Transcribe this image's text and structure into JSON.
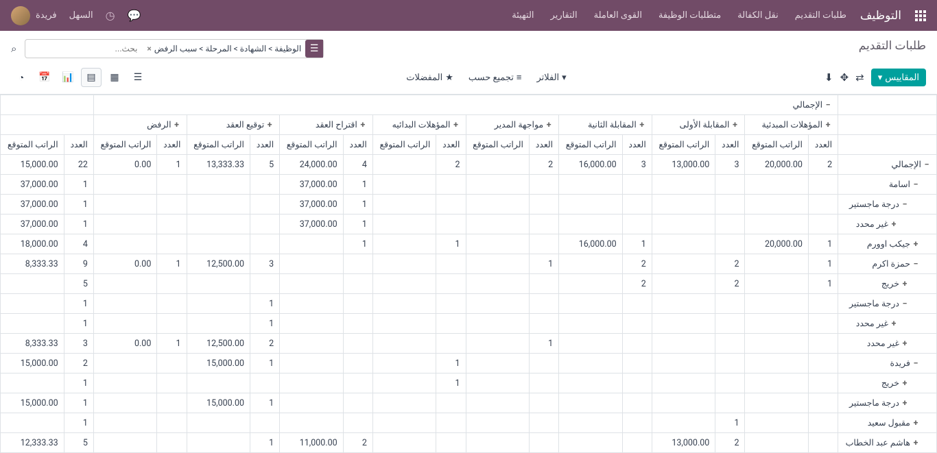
{
  "nav": {
    "brand": "التوظيف",
    "menu": [
      "طلبات التقديم",
      "نقل الكفالة",
      "متطلبات الوظيفة",
      "القوى العاملة",
      "التقارير",
      "التهيئة"
    ],
    "company": "السهل",
    "user": "فريدة"
  },
  "header": {
    "title": "طلبات التقديم",
    "search_chip": "الوظيفة > الشهادة  > المرحلة > سبب الرفض",
    "search_placeholder": "بحث..."
  },
  "toolbar": {
    "measures": "المقاييس",
    "filters": "الفلاتر",
    "groupby": "تجميع حسب",
    "favorites": "المفضلات"
  },
  "pivot": {
    "total_label": "الإجمالي",
    "col_groups": [
      "المؤهلات المبدئية",
      "المقابلة الأولى",
      "المقابلة الثانية",
      "مواجهة المدير",
      "المؤهلات البدائيه",
      "اقتراح العقد",
      "توقيع العقد",
      "الرفض"
    ],
    "sub_cols": [
      "العدد",
      "الراتب المتوقع"
    ],
    "row_total_cols": [
      "العدد",
      "الراتب المتوقع"
    ],
    "rows": [
      {
        "label": "الإجمالي",
        "indent": 0,
        "exp": "−",
        "cells": [
          "2",
          "20,000.00",
          "3",
          "13,000.00",
          "3",
          "16,000.00",
          "2",
          "",
          "2",
          "",
          "4",
          "24,000.00",
          "5",
          "13,333.33",
          "1",
          "0.00"
        ],
        "tot": [
          "22",
          "15,000.00"
        ]
      },
      {
        "label": "اسامة",
        "indent": 1,
        "exp": "−",
        "cells": [
          "",
          "",
          "",
          "",
          "",
          "",
          "",
          "",
          "",
          "",
          "1",
          "37,000.00",
          "",
          "",
          "",
          ""
        ],
        "tot": [
          "1",
          "37,000.00"
        ]
      },
      {
        "label": "درجة ماجستير",
        "indent": 2,
        "exp": "−",
        "cells": [
          "",
          "",
          "",
          "",
          "",
          "",
          "",
          "",
          "",
          "",
          "1",
          "37,000.00",
          "",
          "",
          "",
          ""
        ],
        "tot": [
          "1",
          "37,000.00"
        ]
      },
      {
        "label": "غير محدد",
        "indent": 3,
        "exp": "+",
        "cells": [
          "",
          "",
          "",
          "",
          "",
          "",
          "",
          "",
          "",
          "",
          "1",
          "37,000.00",
          "",
          "",
          "",
          ""
        ],
        "tot": [
          "1",
          "37,000.00"
        ]
      },
      {
        "label": "جيكب اوورم",
        "indent": 1,
        "exp": "+",
        "cells": [
          "1",
          "20,000.00",
          "",
          "",
          "1",
          "16,000.00",
          "",
          "",
          "1",
          "",
          "1",
          "",
          "",
          "",
          "",
          ""
        ],
        "tot": [
          "4",
          "18,000.00"
        ]
      },
      {
        "label": "حمزة اكرم",
        "indent": 1,
        "exp": "−",
        "cells": [
          "1",
          "",
          "2",
          "",
          "2",
          "",
          "1",
          "",
          "",
          "",
          "",
          "",
          "3",
          "12,500.00",
          "1",
          "0.00"
        ],
        "tot": [
          "9",
          "8,333.33"
        ]
      },
      {
        "label": "خريج",
        "indent": 2,
        "exp": "+",
        "cells": [
          "1",
          "",
          "2",
          "",
          "2",
          "",
          "",
          "",
          "",
          "",
          "",
          "",
          "",
          "",
          "",
          ""
        ],
        "tot": [
          "5",
          ""
        ]
      },
      {
        "label": "درجة ماجستير",
        "indent": 2,
        "exp": "−",
        "cells": [
          "",
          "",
          "",
          "",
          "",
          "",
          "",
          "",
          "",
          "",
          "",
          "",
          "1",
          "",
          "",
          ""
        ],
        "tot": [
          "1",
          ""
        ]
      },
      {
        "label": "غير محدد",
        "indent": 3,
        "exp": "+",
        "cells": [
          "",
          "",
          "",
          "",
          "",
          "",
          "",
          "",
          "",
          "",
          "",
          "",
          "1",
          "",
          "",
          ""
        ],
        "tot": [
          "1",
          ""
        ]
      },
      {
        "label": "غير محدد",
        "indent": 2,
        "exp": "+",
        "cells": [
          "",
          "",
          "",
          "",
          "",
          "",
          "1",
          "",
          "",
          "",
          "",
          "",
          "2",
          "12,500.00",
          "1",
          "0.00"
        ],
        "tot": [
          "3",
          "8,333.33"
        ]
      },
      {
        "label": "فريدة",
        "indent": 1,
        "exp": "−",
        "cells": [
          "",
          "",
          "",
          "",
          "",
          "",
          "",
          "",
          "1",
          "",
          "",
          "",
          "1",
          "15,000.00",
          "",
          ""
        ],
        "tot": [
          "2",
          "15,000.00"
        ]
      },
      {
        "label": "خريج",
        "indent": 2,
        "exp": "+",
        "cells": [
          "",
          "",
          "",
          "",
          "",
          "",
          "",
          "",
          "1",
          "",
          "",
          "",
          "",
          "",
          "",
          ""
        ],
        "tot": [
          "1",
          ""
        ]
      },
      {
        "label": "درجة ماجستير",
        "indent": 2,
        "exp": "+",
        "cells": [
          "",
          "",
          "",
          "",
          "",
          "",
          "",
          "",
          "",
          "",
          "",
          "",
          "1",
          "15,000.00",
          "",
          ""
        ],
        "tot": [
          "1",
          "15,000.00"
        ]
      },
      {
        "label": "مقبول سعيد",
        "indent": 1,
        "exp": "+",
        "cells": [
          "",
          "",
          "1",
          "",
          "",
          "",
          "",
          "",
          "",
          "",
          "",
          "",
          "",
          "",
          "",
          ""
        ],
        "tot": [
          "1",
          ""
        ]
      },
      {
        "label": "هاشم عبد الخطاب",
        "indent": 1,
        "exp": "+",
        "cells": [
          "",
          "",
          "2",
          "13,000.00",
          "",
          "",
          "",
          "",
          "",
          "",
          "2",
          "11,000.00",
          "1",
          "",
          "",
          ""
        ],
        "tot": [
          "5",
          "12,333.33"
        ]
      }
    ]
  }
}
